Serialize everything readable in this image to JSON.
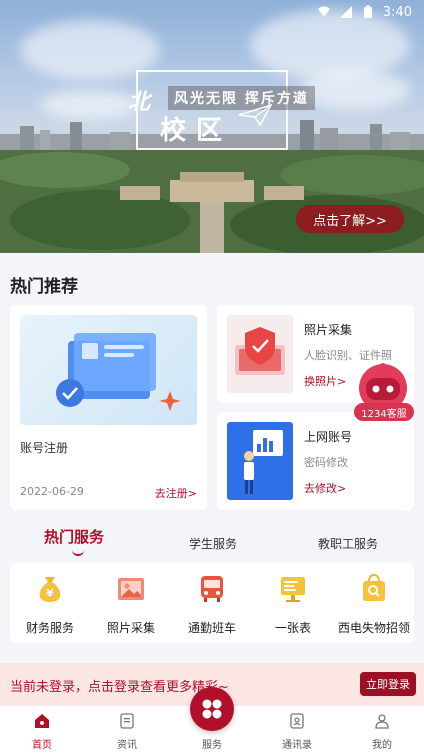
{
  "status_bar": {
    "time": "3:40"
  },
  "hero": {
    "tagline": "风光无限 挥斥方遒",
    "campus_char": "北",
    "campus_name": "校区",
    "cta": "点击了解>>"
  },
  "hot_recommend": {
    "title": "热门推荐",
    "big_card": {
      "title": "账号注册",
      "date": "2022-06-29",
      "link": "去注册>"
    },
    "small_cards": [
      {
        "title": "照片采集",
        "desc": "人脸识别、证件照",
        "link": "换照片>"
      },
      {
        "title": "上网账号",
        "desc": "密码修改",
        "link": "去修改>"
      }
    ]
  },
  "assistant": {
    "label": "1234客服"
  },
  "tabs": [
    {
      "label": "热门服务",
      "active": true
    },
    {
      "label": "学生服务",
      "active": false
    },
    {
      "label": "教职工服务",
      "active": false
    }
  ],
  "services": [
    {
      "label": "财务服务",
      "icon": "money-bag-icon"
    },
    {
      "label": "照片采集",
      "icon": "photo-icon"
    },
    {
      "label": "通勤班车",
      "icon": "bus-icon"
    },
    {
      "label": "一张表",
      "icon": "form-table-icon"
    },
    {
      "label": "西电失物招领",
      "icon": "lost-found-bag-icon"
    }
  ],
  "login_banner": {
    "text": "当前未登录，点击登录查看更多精彩~",
    "button": "立即登录"
  },
  "bottom_nav": [
    {
      "label": "首页",
      "icon": "home-icon",
      "active": true
    },
    {
      "label": "资讯",
      "icon": "news-icon",
      "active": false
    },
    {
      "label": "服务",
      "icon": "services-grid-icon",
      "active": false
    },
    {
      "label": "通讯录",
      "icon": "contacts-icon",
      "active": false
    },
    {
      "label": "我的",
      "icon": "profile-icon",
      "active": false
    }
  ],
  "colors": {
    "brand": "#b0102a",
    "accent_pink": "#d63450",
    "banner_bg": "#fbe6e4"
  }
}
